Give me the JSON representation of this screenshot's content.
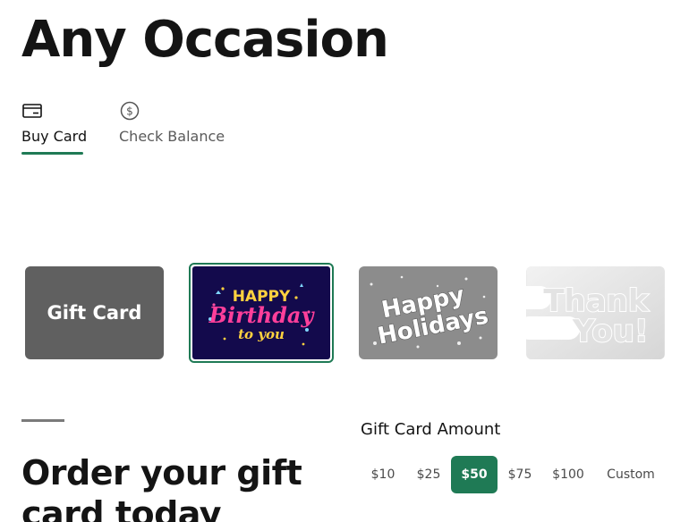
{
  "page": {
    "title": "Any Occasion"
  },
  "tabs": [
    {
      "label": "Buy Card",
      "icon": "credit-card-icon",
      "active": true
    },
    {
      "label": "Check Balance",
      "icon": "dollar-circle-icon",
      "active": false
    }
  ],
  "cards": [
    {
      "label": "Gift Card",
      "style": "plain",
      "selected": false
    },
    {
      "art_text": [
        "HAPPY",
        "Birthday",
        "to you"
      ],
      "style": "birthday",
      "selected": true
    },
    {
      "art_text": [
        "Happy",
        "Holidays"
      ],
      "style": "holidays",
      "selected": false
    },
    {
      "art_text": [
        "Thank",
        "You!"
      ],
      "style": "thank-you",
      "selected": false
    }
  ],
  "order": {
    "heading": "Order your gift card today"
  },
  "amount": {
    "label": "Gift Card Amount",
    "options": [
      "$10",
      "$25",
      "$50",
      "$75",
      "$100",
      "Custom"
    ],
    "selected": "$50"
  },
  "colors": {
    "accent": "#1f7a55",
    "plain_card": "#606060",
    "birthday_bg": "#130a4c"
  }
}
